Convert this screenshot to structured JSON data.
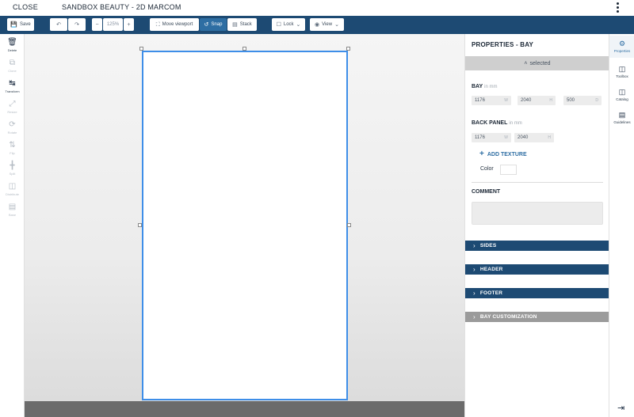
{
  "topbar": {
    "close_label": "CLOSE",
    "title": "SANDBOX BEAUTY - 2D MARCOM",
    "menu_icon": "kebab-menu-icon"
  },
  "toolbar": {
    "save_label": "Save",
    "undo_redo_label": "",
    "zoom_value": "125%",
    "move_viewport_label": "Move viewport",
    "snap_label": "Snap",
    "stack_label": "Stack",
    "lock_label": "Lock",
    "view_label": "View"
  },
  "left_tools": [
    {
      "name": "tool-delete",
      "label": "Delete",
      "icon": "trash-icon",
      "enabled": true
    },
    {
      "name": "tool-clone",
      "label": "Clone",
      "icon": "clone-icon",
      "enabled": false
    },
    {
      "name": "tool-transform",
      "label": "Transform",
      "icon": "transform-icon",
      "enabled": true
    },
    {
      "name": "tool-resize",
      "label": "Resize",
      "icon": "resize-icon",
      "enabled": false
    },
    {
      "name": "tool-rotate",
      "label": "Rotate",
      "icon": "rotate-icon",
      "enabled": false
    },
    {
      "name": "tool-flip",
      "label": "Flip",
      "icon": "flip-icon",
      "enabled": false
    },
    {
      "name": "tool-split",
      "label": "Split",
      "icon": "split-icon",
      "enabled": false
    },
    {
      "name": "tool-distribute",
      "label": "Distribute",
      "icon": "distribute-icon",
      "enabled": false
    },
    {
      "name": "tool-base",
      "label": "Base",
      "icon": "base-icon",
      "enabled": false
    }
  ],
  "properties": {
    "title": "PROPERTIES - BAY",
    "selected_label": "selected",
    "bay_label": "BAY",
    "bay_unit": "in mm",
    "bay_fields": [
      {
        "value": "1176",
        "axis": "W"
      },
      {
        "value": "2040",
        "axis": "H"
      },
      {
        "value": "500",
        "axis": "D"
      }
    ],
    "back_panel_label": "BACK PANEL",
    "back_panel_unit": "in mm",
    "back_panel_fields": [
      {
        "value": "1176",
        "axis": "W"
      },
      {
        "value": "2040",
        "axis": "H"
      }
    ],
    "add_texture_label": "ADD TEXTURE",
    "color_label": "Color",
    "comment_label": "COMMENT",
    "sections": [
      {
        "label": "SIDES",
        "style": "blue"
      },
      {
        "label": "HEADER",
        "style": "blue"
      },
      {
        "label": "FOOTER",
        "style": "blue"
      },
      {
        "label": "BAY CUSTOMIZATION",
        "style": "grey"
      }
    ]
  },
  "right_rail": [
    {
      "name": "rail-properties",
      "label": "Properties",
      "icon": "properties-icon",
      "active": true
    },
    {
      "name": "rail-toolbox",
      "label": "Toolbox",
      "icon": "toolbox-icon",
      "active": false
    },
    {
      "name": "rail-catalog",
      "label": "Catalog",
      "icon": "catalog-icon",
      "active": false
    },
    {
      "name": "rail-guidelines",
      "label": "Guidelines",
      "icon": "guidelines-icon",
      "active": false
    }
  ],
  "colors": {
    "toolbar": "#1d4a73",
    "accent": "#2e6ea3",
    "selection": "#3e8ee8",
    "floor": "#6b6b6b"
  }
}
